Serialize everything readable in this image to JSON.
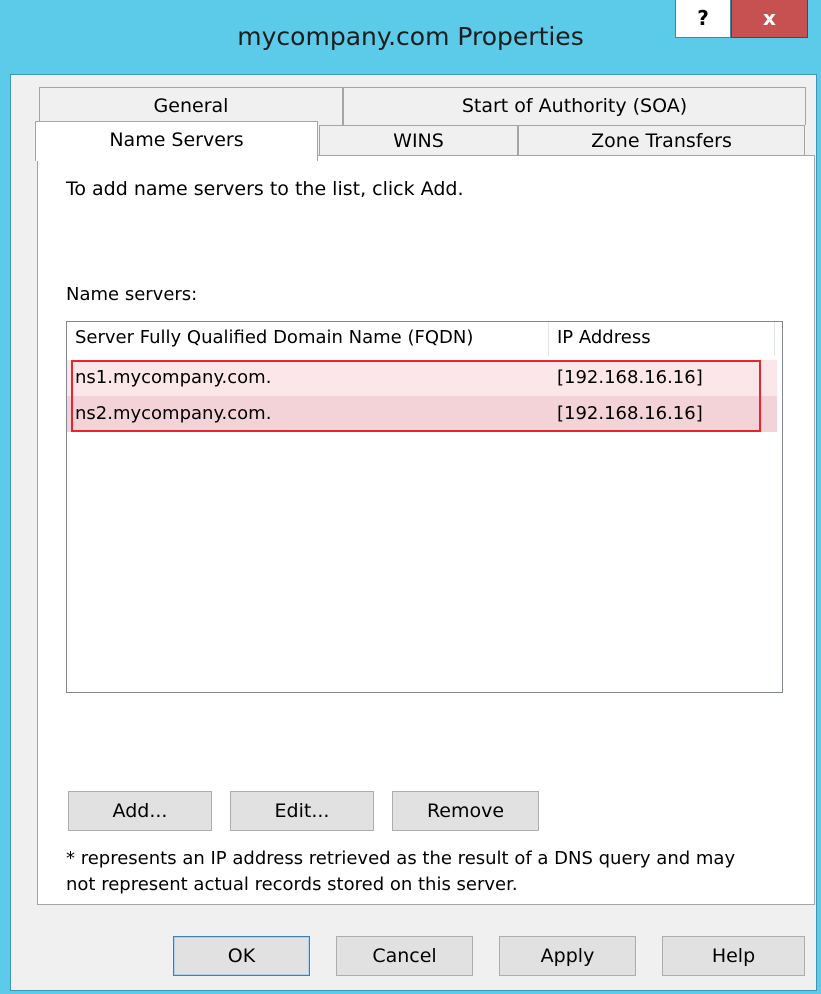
{
  "window": {
    "title": "mycompany.com Properties",
    "help_glyph": "?",
    "close_glyph": "x"
  },
  "tabs": [
    {
      "label": "General"
    },
    {
      "label": "Start of Authority (SOA)"
    },
    {
      "label": "Name Servers",
      "active": true
    },
    {
      "label": "WINS"
    },
    {
      "label": "Zone Transfers"
    }
  ],
  "panel": {
    "instruction": "To add name servers to the list, click Add.",
    "list_label": "Name servers:",
    "columns": [
      "Server Fully Qualified Domain Name (FQDN)",
      "IP Address"
    ],
    "rows": [
      {
        "fqdn": "ns1.mycompany.com.",
        "ip": "[192.168.16.16]"
      },
      {
        "fqdn": "ns2.mycompany.com.",
        "ip": "[192.168.16.16]"
      }
    ],
    "buttons": {
      "add": "Add...",
      "edit": "Edit...",
      "remove": "Remove"
    },
    "note": "* represents an IP address retrieved as the result of a DNS query and may not represent actual records stored on this server."
  },
  "footer": {
    "ok": "OK",
    "cancel": "Cancel",
    "apply": "Apply",
    "help": "Help"
  },
  "colors": {
    "titlebar": "#5ccae9",
    "close": "#c75050",
    "highlight_border": "#e8242d"
  }
}
